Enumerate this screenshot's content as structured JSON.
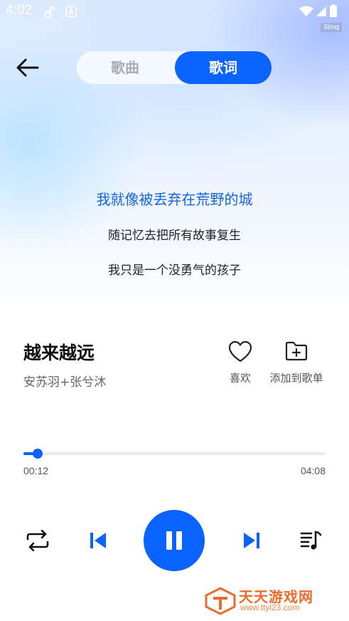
{
  "status_bar": {
    "time": "4:02",
    "badge": "6lmq"
  },
  "header": {
    "tabs": [
      {
        "label": "歌曲",
        "active": false
      },
      {
        "label": "歌词",
        "active": true
      }
    ]
  },
  "lyrics": {
    "lines": [
      {
        "text": "我就像被丢弃在荒野的城",
        "active": true
      },
      {
        "text": "随记忆去把所有故事复生",
        "active": false
      },
      {
        "text": "我只是一个没勇气的孩子",
        "active": false
      }
    ]
  },
  "song": {
    "title": "越来越远",
    "artist": "安苏羽+张兮沐",
    "actions": {
      "like_label": "喜欢",
      "add_to_playlist_label": "添加到歌单"
    }
  },
  "progress": {
    "current_time": "00:12",
    "total_time": "04:08",
    "fraction": 0.048
  },
  "controls": {
    "repeat_icon": "repeat-icon",
    "prev_icon": "skip-previous-icon",
    "play_state": "playing",
    "next_icon": "skip-next-icon",
    "playlist_icon": "playlist-icon"
  },
  "watermark": {
    "text": "天天游戏网",
    "url": "www.ttyl23.com"
  },
  "colors": {
    "accent": "#0a63ff",
    "active_lyric": "#1565e0"
  }
}
